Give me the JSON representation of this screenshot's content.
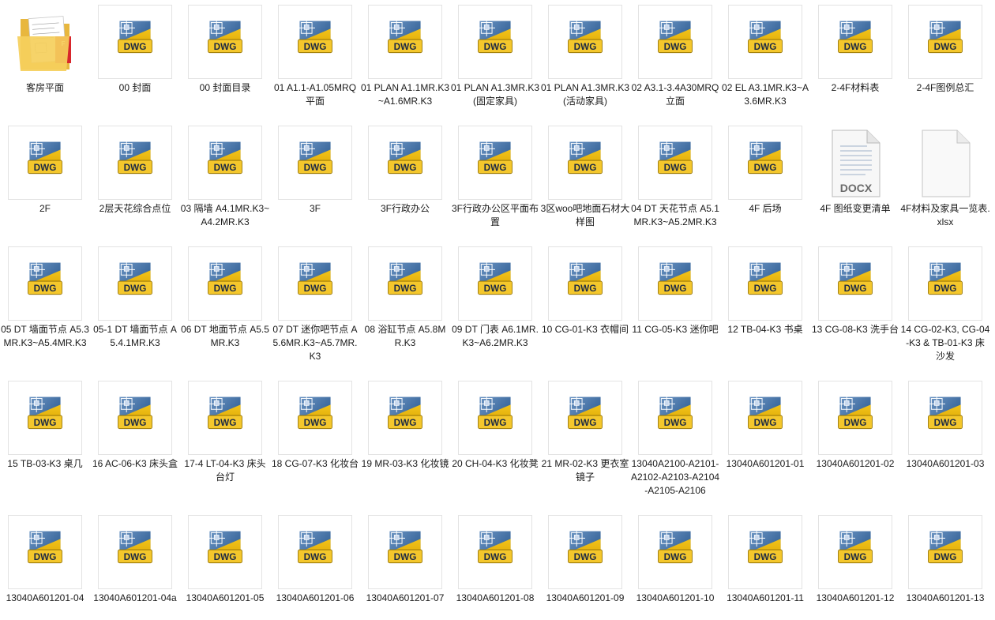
{
  "colors": {
    "dwg_blue_dark": "#1f4f86",
    "dwg_blue_light": "#6c95c4",
    "dwg_yellow": "#f2c21a",
    "dwg_yellow_dark": "#d9a400",
    "folder_yellow": "#f5cf5c",
    "folder_red": "#d8262c",
    "label_text": "#1a1a1a"
  },
  "files": [
    {
      "name": "客房平面",
      "kind": "folder"
    },
    {
      "name": "00 封面",
      "kind": "dwg"
    },
    {
      "name": "00 封面目录",
      "kind": "dwg"
    },
    {
      "name": "01 A1.1-A1.05MRQ平面",
      "kind": "dwg"
    },
    {
      "name": "01 PLAN A1.1MR.K3~A1.6MR.K3",
      "kind": "dwg"
    },
    {
      "name": "01 PLAN A1.3MR.K3(固定家具)",
      "kind": "dwg"
    },
    {
      "name": "01 PLAN A1.3MR.K3(活动家具)",
      "kind": "dwg"
    },
    {
      "name": "02 A3.1-3.4A30MRQ立面",
      "kind": "dwg"
    },
    {
      "name": "02 EL A3.1MR.K3~A3.6MR.K3",
      "kind": "dwg"
    },
    {
      "name": "2-4F材料表",
      "kind": "dwg"
    },
    {
      "name": "2-4F图例总汇",
      "kind": "dwg"
    },
    {
      "name": "2F",
      "kind": "dwg"
    },
    {
      "name": "2层天花综合点位",
      "kind": "dwg"
    },
    {
      "name": "03 隔墙 A4.1MR.K3~A4.2MR.K3",
      "kind": "dwg"
    },
    {
      "name": "3F",
      "kind": "dwg"
    },
    {
      "name": "3F行政办公",
      "kind": "dwg"
    },
    {
      "name": "3F行政办公区平面布置",
      "kind": "dwg"
    },
    {
      "name": "3区woo吧地面石材大样图",
      "kind": "dwg"
    },
    {
      "name": "04 DT 天花节点 A5.1MR.K3~A5.2MR.K3",
      "kind": "dwg"
    },
    {
      "name": "4F 后场",
      "kind": "dwg"
    },
    {
      "name": "4F 图纸变更清单",
      "kind": "docx",
      "badge": "DOCX"
    },
    {
      "name": "4F材料及家具一览表.xlsx",
      "kind": "blank"
    },
    {
      "name": "05 DT 墙面节点 A5.3MR.K3~A5.4MR.K3",
      "kind": "dwg"
    },
    {
      "name": "05-1 DT 墙面节点 A5.4.1MR.K3",
      "kind": "dwg"
    },
    {
      "name": "06 DT 地面节点 A5.5MR.K3",
      "kind": "dwg"
    },
    {
      "name": "07 DT 迷你吧节点 A5.6MR.K3~A5.7MR.K3",
      "kind": "dwg"
    },
    {
      "name": "08 浴缸节点 A5.8MR.K3",
      "kind": "dwg"
    },
    {
      "name": "09 DT 门表 A6.1MR.K3~A6.2MR.K3",
      "kind": "dwg"
    },
    {
      "name": "10 CG-01-K3 衣帽间",
      "kind": "dwg"
    },
    {
      "name": "11 CG-05-K3 迷你吧",
      "kind": "dwg"
    },
    {
      "name": "12 TB-04-K3 书桌",
      "kind": "dwg"
    },
    {
      "name": "13 CG-08-K3 洗手台",
      "kind": "dwg"
    },
    {
      "name": "14 CG-02-K3, CG-04-K3 & TB-01-K3 床 沙发",
      "kind": "dwg"
    },
    {
      "name": "15 TB-03-K3 桌几",
      "kind": "dwg"
    },
    {
      "name": "16 AC-06-K3 床头盒",
      "kind": "dwg"
    },
    {
      "name": "17-4 LT-04-K3 床头台灯",
      "kind": "dwg"
    },
    {
      "name": "18 CG-07-K3 化妆台",
      "kind": "dwg"
    },
    {
      "name": "19 MR-03-K3 化妆镜",
      "kind": "dwg"
    },
    {
      "name": "20 CH-04-K3 化妆凳",
      "kind": "dwg"
    },
    {
      "name": "21 MR-02-K3 更衣室镜子",
      "kind": "dwg"
    },
    {
      "name": "13040A2100-A2101-A2102-A2103-A2104-A2105-A2106",
      "kind": "dwg"
    },
    {
      "name": "13040A601201-01",
      "kind": "dwg"
    },
    {
      "name": "13040A601201-02",
      "kind": "dwg"
    },
    {
      "name": "13040A601201-03",
      "kind": "dwg"
    },
    {
      "name": "13040A601201-04",
      "kind": "dwg"
    },
    {
      "name": "13040A601201-04a",
      "kind": "dwg"
    },
    {
      "name": "13040A601201-05",
      "kind": "dwg"
    },
    {
      "name": "13040A601201-06",
      "kind": "dwg"
    },
    {
      "name": "13040A601201-07",
      "kind": "dwg"
    },
    {
      "name": "13040A601201-08",
      "kind": "dwg"
    },
    {
      "name": "13040A601201-09",
      "kind": "dwg"
    },
    {
      "name": "13040A601201-10",
      "kind": "dwg"
    },
    {
      "name": "13040A601201-11",
      "kind": "dwg"
    },
    {
      "name": "13040A601201-12",
      "kind": "dwg"
    },
    {
      "name": "13040A601201-13",
      "kind": "dwg"
    }
  ],
  "dwg_badge": "DWG"
}
